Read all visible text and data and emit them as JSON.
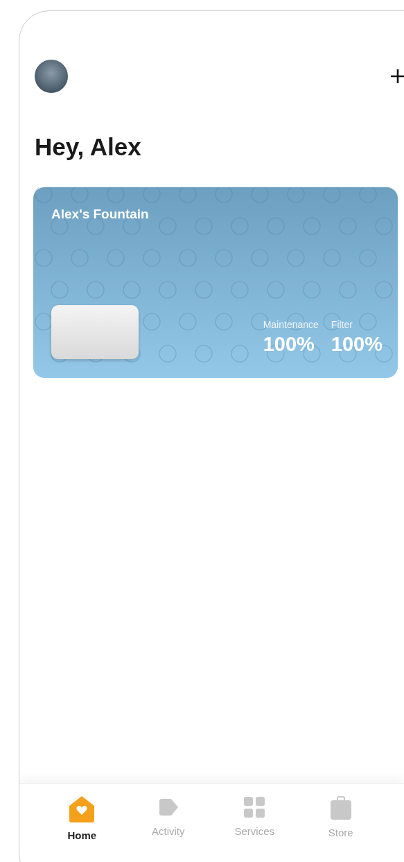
{
  "header": {
    "greeting": "Hey, Alex"
  },
  "device_card": {
    "name": "Alex's Fountain",
    "stats": [
      {
        "label": "Maintenance",
        "value": "100%"
      },
      {
        "label": "Filter",
        "value": "100%"
      }
    ]
  },
  "tab_bar": [
    {
      "kind": "home",
      "label": "Home",
      "selected": true
    },
    {
      "kind": "activity",
      "label": "Activity",
      "selected": false
    },
    {
      "kind": "services",
      "label": "Services",
      "selected": false
    },
    {
      "kind": "store",
      "label": "Store",
      "selected": false
    }
  ]
}
